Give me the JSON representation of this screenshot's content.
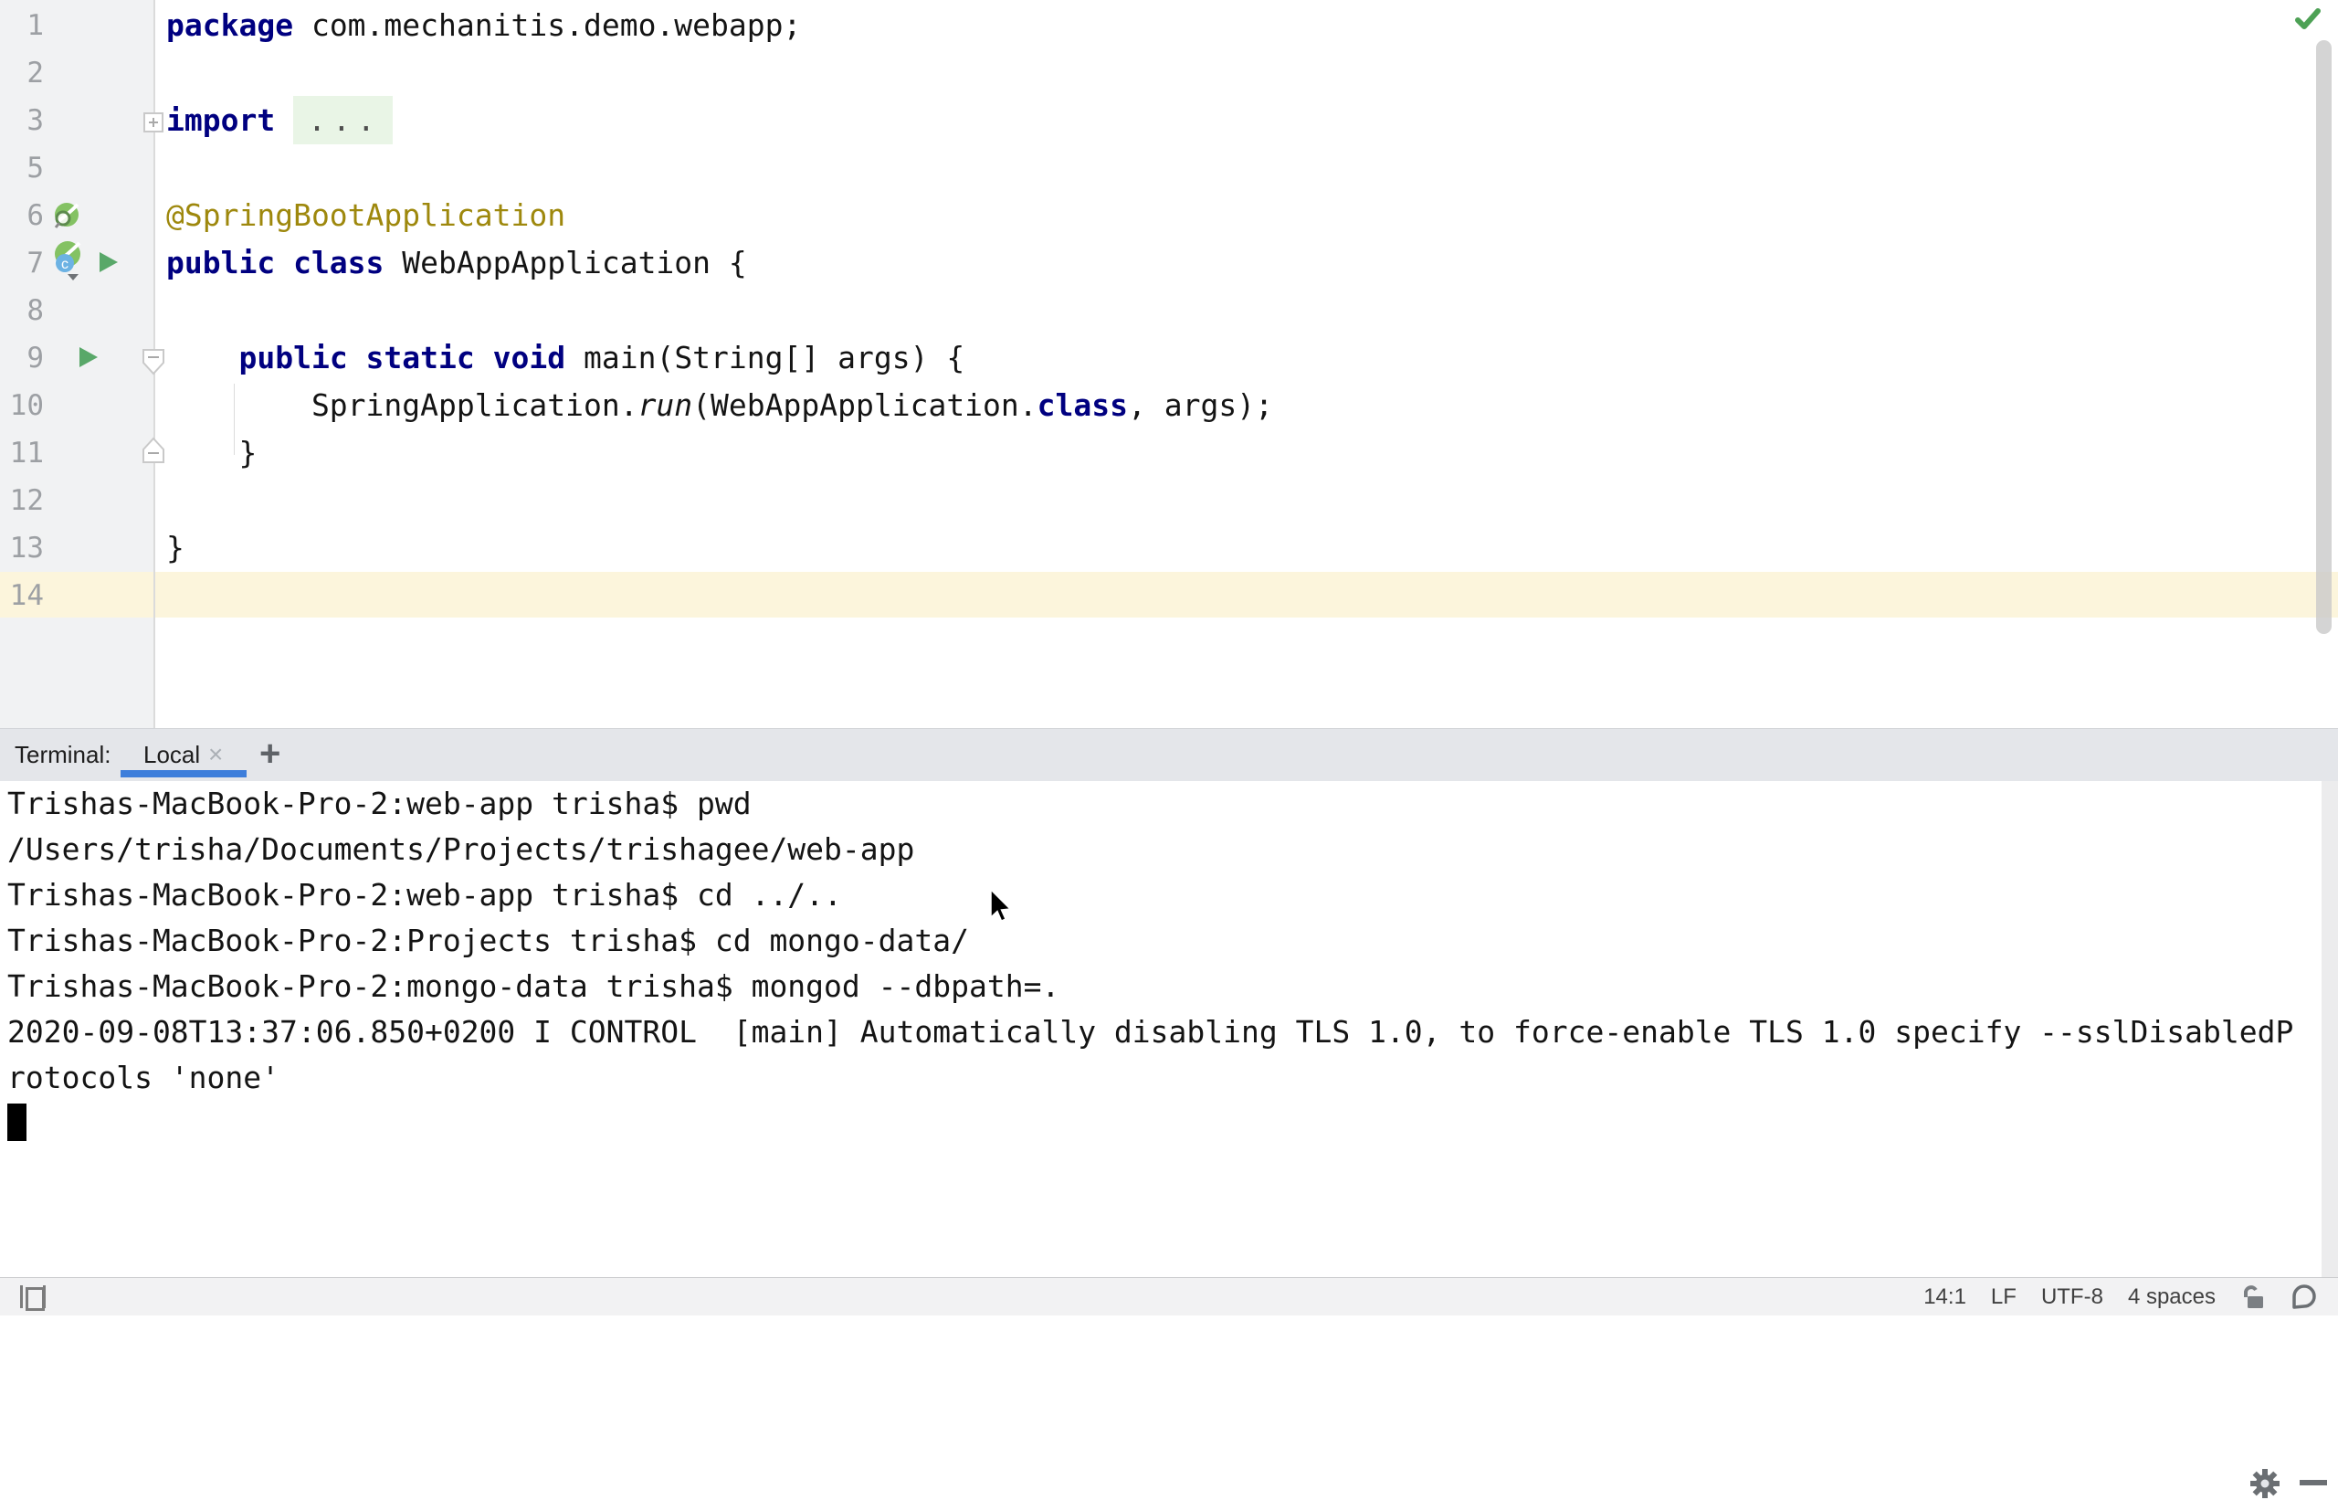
{
  "editor": {
    "file_language": "java",
    "rows": [
      {
        "num": "1",
        "tokens": [
          [
            "kw",
            "package"
          ],
          [
            "pl",
            " com.mechanitis.demo.webapp;"
          ]
        ]
      },
      {
        "num": "2",
        "tokens": []
      },
      {
        "num": "3",
        "tokens": [
          [
            "kw",
            "import"
          ],
          [
            "pl",
            " "
          ],
          [
            "fold",
            "..."
          ]
        ],
        "folded_import": true
      },
      {
        "num": "5",
        "tokens": []
      },
      {
        "num": "6",
        "tokens": [
          [
            "ann",
            "@SpringBootApplication"
          ]
        ]
      },
      {
        "num": "7",
        "tokens": [
          [
            "kw",
            "public class"
          ],
          [
            "pl",
            " WebAppApplication {"
          ]
        ]
      },
      {
        "num": "8",
        "tokens": []
      },
      {
        "num": "9",
        "tokens": [
          [
            "pl",
            "    "
          ],
          [
            "kw",
            "public static void"
          ],
          [
            "pl",
            " main(String[] args) {"
          ]
        ]
      },
      {
        "num": "10",
        "tokens": [
          [
            "pl",
            "        SpringApplication."
          ],
          [
            "it",
            "run"
          ],
          [
            "pl",
            "(WebAppApplication."
          ],
          [
            "kw",
            "class"
          ],
          [
            "pl",
            ", args);"
          ]
        ]
      },
      {
        "num": "11",
        "tokens": [
          [
            "pl",
            "    }"
          ]
        ]
      },
      {
        "num": "12",
        "tokens": []
      },
      {
        "num": "13",
        "tokens": [
          [
            "pl",
            "}"
          ]
        ]
      },
      {
        "num": "14",
        "tokens": [],
        "caret_row": true
      }
    ],
    "gutter_icons": [
      "spring-bean-search-icon",
      "spring-boot-class-icon",
      "run-icon",
      "run-icon"
    ],
    "fold_markers": [
      "fold-plus-box",
      "fold-start-pentagon",
      "fold-end-pentagon"
    ],
    "inspection_status_icon": "no-problems-checkmark-icon"
  },
  "terminal": {
    "panel_label": "Terminal:",
    "tab": {
      "label": "Local",
      "close_glyph": "×"
    },
    "new_tab_glyph": "+",
    "header_icons": [
      "gear-icon",
      "hide-panel-icon"
    ],
    "lines": [
      "Trishas-MacBook-Pro-2:web-app trisha$ pwd",
      "/Users/trisha/Documents/Projects/trishagee/web-app",
      "Trishas-MacBook-Pro-2:web-app trisha$ cd ../..",
      "Trishas-MacBook-Pro-2:Projects trisha$ cd mongo-data/",
      "Trishas-MacBook-Pro-2:mongo-data trisha$ mongod --dbpath=.",
      "2020-09-08T13:37:06.850+0200 I CONTROL  [main] Automatically disabling TLS 1.0, to force-enable TLS 1.0 specify --sslDisabledP",
      "rotocols 'none'"
    ],
    "cursor": "block"
  },
  "statusbar": {
    "items": [
      {
        "name": "caret-position",
        "label": "14:1"
      },
      {
        "name": "line-separator",
        "label": "LF"
      },
      {
        "name": "encoding",
        "label": "UTF-8"
      },
      {
        "name": "indent-style",
        "label": "4 spaces"
      }
    ],
    "icons": [
      "toolwindow-toggle-icon",
      "lock-icon",
      "event-balloon-icon"
    ]
  },
  "colors": {
    "keyword": "#000080",
    "annotation": "#9E880D",
    "caret_row": "#FCF5DC",
    "tab_underline": "#3D7EDB",
    "run_green": "#59A869",
    "check_green": "#4DA155"
  }
}
